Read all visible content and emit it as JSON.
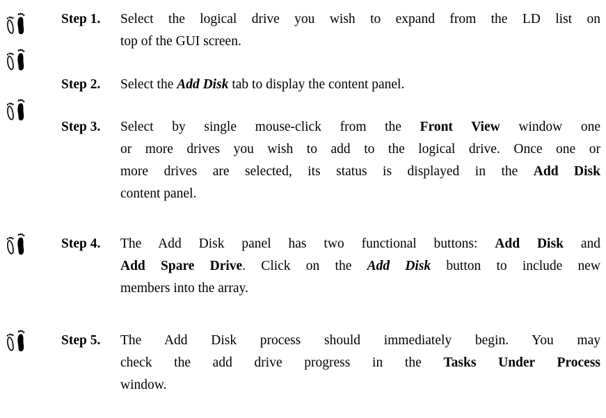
{
  "icons": {
    "step_icon": "footprints-icon"
  },
  "steps": [
    {
      "label": "Step 1.",
      "lines": [
        [
          {
            "t": "Select the logical drive you wish to expand from the LD list on",
            "s": ""
          }
        ],
        [
          {
            "t": "top of the GUI screen.",
            "s": ""
          }
        ]
      ]
    },
    {
      "label": "Step 2.",
      "lines": [
        [
          {
            "t": "Select the ",
            "s": ""
          },
          {
            "t": "Add Disk",
            "s": "bi"
          },
          {
            "t": " tab to display the content panel.",
            "s": ""
          }
        ]
      ]
    },
    {
      "label": "Step 3.",
      "lines": [
        [
          {
            "t": "Select by single mouse-click from the ",
            "s": ""
          },
          {
            "t": "Front View",
            "s": "b"
          },
          {
            "t": " window one",
            "s": ""
          }
        ],
        [
          {
            "t": "or more drives you wish to add to the logical drive. Once one or",
            "s": ""
          }
        ],
        [
          {
            "t": "more drives are selected, its status is displayed in the ",
            "s": ""
          },
          {
            "t": "Add Disk",
            "s": "b"
          }
        ],
        [
          {
            "t": "content panel.",
            "s": ""
          }
        ]
      ]
    },
    {
      "label": "Step 4.",
      "lines": [
        [
          {
            "t": "The Add Disk panel has two functional buttons: ",
            "s": ""
          },
          {
            "t": "Add Disk",
            "s": "b"
          },
          {
            "t": " and",
            "s": ""
          }
        ],
        [
          {
            "t": "Add Spare Drive",
            "s": "b"
          },
          {
            "t": ". Click on the ",
            "s": ""
          },
          {
            "t": "Add Disk",
            "s": "bi"
          },
          {
            "t": " button to include new",
            "s": ""
          }
        ],
        [
          {
            "t": "members into the array.",
            "s": ""
          }
        ]
      ]
    },
    {
      "label": "Step 5.",
      "lines": [
        [
          {
            "t": "The Add Disk process should immediately begin.  You may",
            "s": ""
          }
        ],
        [
          {
            "t": "check the add drive progress in the ",
            "s": ""
          },
          {
            "t": "Tasks Under Process",
            "s": "b"
          }
        ],
        [
          {
            "t": "window.",
            "s": ""
          }
        ]
      ]
    }
  ]
}
